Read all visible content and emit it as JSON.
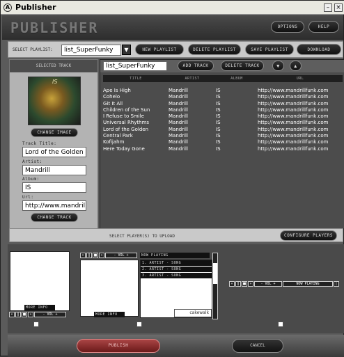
{
  "window": {
    "title": "Publisher",
    "minimize": "–",
    "close": "×"
  },
  "header": {
    "logo": "PUBLISHER",
    "options_label": "OPTIONS",
    "help_label": "HELP"
  },
  "playlist_bar": {
    "select_label": "SELECT PLAYLIST:",
    "selected_playlist": "list_SuperFunky",
    "new_label": "NEW PLAYLIST",
    "delete_label": "DELETE PLAYLIST",
    "save_label": "SAVE PLAYLIST",
    "download_label": "DOWNLOAD"
  },
  "selected_track": {
    "header": "SELECTED TRACK",
    "album_art_text": "IS",
    "change_image_label": "CHANGE IMAGE",
    "title_label": "Track Title:",
    "title_value": "Lord of the Golden",
    "artist_label": "Artist:",
    "artist_value": "Mandrill",
    "album_label": "Album:",
    "album_value": "IS",
    "url_label": "Url:",
    "url_value": "http://www.mandrill.com",
    "change_track_label": "CHANGE TRACK"
  },
  "playlist_panel": {
    "name": "list_SuperFunky",
    "add_track_label": "ADD TRACK",
    "delete_track_label": "DELETE TRACK",
    "columns": [
      "TITLE",
      "ARTIST",
      "ALBUM",
      "URL"
    ],
    "rows": [
      [
        "Ape Is High",
        "Mandrill",
        "IS",
        "http://www.mandrillfunk.com"
      ],
      [
        "Cohelo",
        "Mandrill",
        "IS",
        "http://www.mandrillfunk.com"
      ],
      [
        "Git It All",
        "Mandrill",
        "IS",
        "http://www.mandrillfunk.com"
      ],
      [
        "Children of the Sun",
        "Mandrill",
        "IS",
        "http://www.mandrillfunk.com"
      ],
      [
        "I Refuse to Smile",
        "Mandrill",
        "IS",
        "http://www.mandrillfunk.com"
      ],
      [
        "Universal Rhythms",
        "Mandrill",
        "IS",
        "http://www.mandrillfunk.com"
      ],
      [
        "Lord of the Golden",
        "Mandrill",
        "IS",
        "http://www.mandrillfunk.com"
      ],
      [
        "Central Park",
        "Mandrill",
        "IS",
        "http://www.mandrillfunk.com"
      ],
      [
        "Kofijahm",
        "Mandrill",
        "IS",
        "http://www.mandrillfunk.com"
      ],
      [
        "Here Today Gone",
        "Mandrill",
        "IS",
        "http://www.mandrillfunk.com"
      ]
    ]
  },
  "players_bar": {
    "label": "SELECT PLAYER(S) TO UPLOAD",
    "configure_label": "CONFIGURE PLAYERS"
  },
  "players": {
    "more_info_label": "MORE INFO",
    "vol_label": "- VOL +",
    "now_playing_label": "NOW PLAYING",
    "list_items": [
      "1. ARTIST - SONG",
      "2. ARTIST - SONG",
      "3. ARTIST - SONG"
    ],
    "brand_label": "cakewalk"
  },
  "footer": {
    "publish_label": "PUBLISH",
    "cancel_label": "CANCEL"
  }
}
